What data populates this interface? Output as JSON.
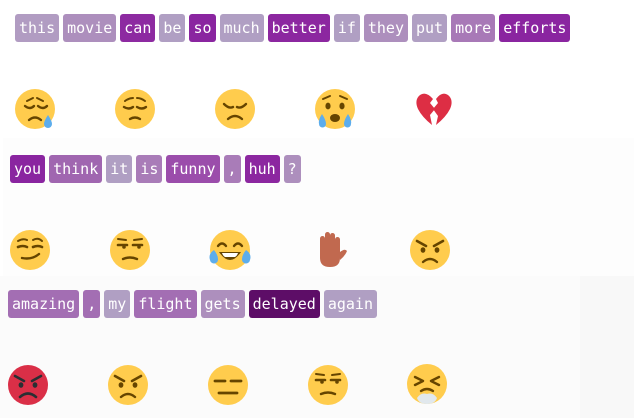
{
  "rows": [
    {
      "tokens": [
        {
          "text": "this",
          "color": "#b19cc2"
        },
        {
          "text": "movie",
          "color": "#ad8fbd"
        },
        {
          "text": "can",
          "color": "#8d2aa1"
        },
        {
          "text": "be",
          "color": "#b09fc3"
        },
        {
          "text": "so",
          "color": "#8a25a0"
        },
        {
          "text": "much",
          "color": "#b09fc3"
        },
        {
          "text": "better",
          "color": "#8c27a0"
        },
        {
          "text": "if",
          "color": "#b09fc3"
        },
        {
          "text": "they",
          "color": "#ad8fbd"
        },
        {
          "text": "put",
          "color": "#b09fc3"
        },
        {
          "text": "more",
          "color": "#a879b7"
        },
        {
          "text": "efforts",
          "color": "#8a25a0"
        }
      ],
      "emojis": [
        "sad-relieved-crying-face",
        "pensive-face",
        "disappointed-face",
        "crying-face",
        "broken-heart"
      ]
    },
    {
      "tokens": [
        {
          "text": "you",
          "color": "#8a25a0"
        },
        {
          "text": "think",
          "color": "#a066b0"
        },
        {
          "text": "it",
          "color": "#b09fc3"
        },
        {
          "text": "is",
          "color": "#a97cb8"
        },
        {
          "text": "funny",
          "color": "#9b4dab"
        },
        {
          "text": ",",
          "color": "#a97cb8"
        },
        {
          "text": "huh",
          "color": "#8c27a0"
        },
        {
          "text": "?",
          "color": "#ad8fbd"
        }
      ],
      "emojis": [
        "smirking-face",
        "unamused-face",
        "tears-of-joy-face",
        "raised-hand",
        "angry-face"
      ]
    },
    {
      "tokens": [
        {
          "text": "amazing",
          "color": "#a36eb3"
        },
        {
          "text": ",",
          "color": "#a36eb3"
        },
        {
          "text": "my",
          "color": "#b09fc3"
        },
        {
          "text": "flight",
          "color": "#a36eb3"
        },
        {
          "text": "gets",
          "color": "#ad8fbd"
        },
        {
          "text": "delayed",
          "color": "#5d0d67"
        },
        {
          "text": "again",
          "color": "#b09fc3"
        }
      ],
      "emojis": [
        "pouting-red-face",
        "angry-face",
        "expressionless-face",
        "unamused-face",
        "steam-from-nose-face"
      ]
    }
  ]
}
